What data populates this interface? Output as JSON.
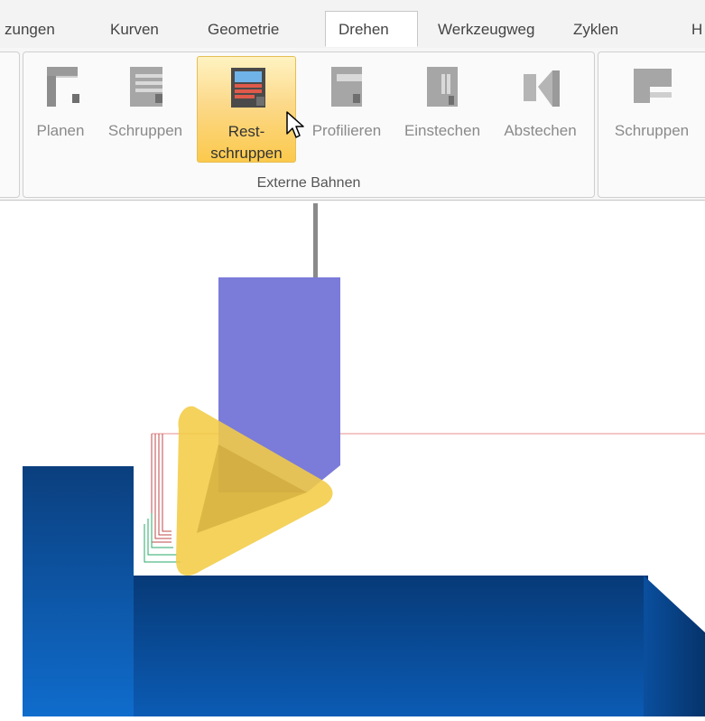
{
  "tabs": [
    {
      "label": "zungen"
    },
    {
      "label": "Kurven"
    },
    {
      "label": "Geometrie"
    },
    {
      "label": "Drehen"
    },
    {
      "label": "Werkzeugweg"
    },
    {
      "label": "Zyklen"
    },
    {
      "label": "H"
    }
  ],
  "ribbon": {
    "group_label": "Externe Bahnen",
    "buttons": [
      {
        "label": "Planen",
        "icon": "facing-icon"
      },
      {
        "label": "Schruppen",
        "icon": "roughing-icon"
      },
      {
        "label": "Rest-",
        "label2": "schruppen",
        "icon": "rest-roughing-icon"
      },
      {
        "label": "Profilieren",
        "icon": "profiling-icon"
      },
      {
        "label": "Einstechen",
        "icon": "grooving-icon"
      },
      {
        "label": "Abstechen",
        "icon": "parting-icon"
      }
    ],
    "second_group_button": {
      "label": "Schruppen",
      "icon": "roughing-icon"
    }
  },
  "colors": {
    "tool_holder": "#7b7bd9",
    "insert": "#f2cc45",
    "workpiece": "#0d5ba8",
    "ribbon_active": "#fbc94c"
  }
}
